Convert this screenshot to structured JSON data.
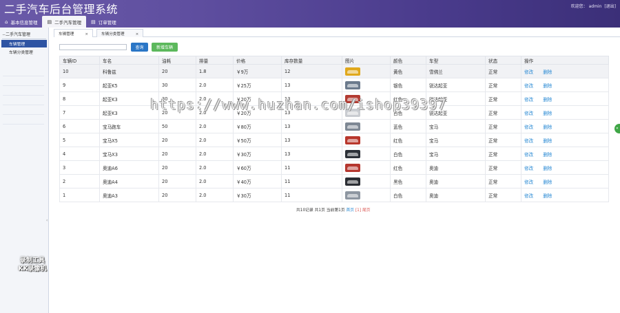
{
  "header": {
    "title": "二手汽车后台管理系统",
    "welcome": "欢迎您：",
    "username": "admin",
    "logout": "[退出]"
  },
  "topnav": [
    {
      "label": "基本信息管理",
      "icon": "home-icon"
    },
    {
      "label": "二手汽车管理",
      "icon": "document-icon"
    },
    {
      "label": "订单管理",
      "icon": "document-icon"
    }
  ],
  "sidebar": {
    "group": "二手汽车管理",
    "items": [
      "车辆管理",
      "车辆分类管理"
    ]
  },
  "tabs": [
    "车辆管理",
    "车辆分类管理"
  ],
  "toolbar": {
    "search_value": "",
    "query_label": "查询",
    "add_label": "新增车辆"
  },
  "table": {
    "headers": [
      "车辆ID",
      "车名",
      "油耗",
      "排量",
      "价格",
      "库存数量",
      "图片",
      "颜色",
      "车型",
      "状态",
      "操作"
    ],
    "edit_label": "修改",
    "delete_label": "删除",
    "rows": [
      {
        "id": "10",
        "name": "科鲁兹",
        "fuel": "20",
        "displacement": "1.8",
        "price": "￥9万",
        "stock": "12",
        "thumb_color": "#e0a81c",
        "color": "黄色",
        "model": "雪佛兰",
        "status": "正常"
      },
      {
        "id": "9",
        "name": "起亚K5",
        "fuel": "30",
        "displacement": "2.0",
        "price": "￥25万",
        "stock": "13",
        "thumb_color": "#6b7a8c",
        "color": "银色",
        "model": "锐达起亚",
        "status": "正常"
      },
      {
        "id": "8",
        "name": "起亚K3",
        "fuel": "30",
        "displacement": "2.0",
        "price": "￥20万",
        "stock": "13",
        "thumb_color": "#b23b32",
        "color": "红色",
        "model": "锐达起亚",
        "status": "正常"
      },
      {
        "id": "7",
        "name": "起亚K3",
        "fuel": "20",
        "displacement": "2.0",
        "price": "￥20万",
        "stock": "13",
        "thumb_color": "#c9ccd1",
        "color": "白色",
        "model": "锐达起亚",
        "status": "正常"
      },
      {
        "id": "6",
        "name": "宝马跑车",
        "fuel": "50",
        "displacement": "2.0",
        "price": "￥80万",
        "stock": "13",
        "thumb_color": "#7e8894",
        "color": "蓝色",
        "model": "宝马",
        "status": "正常"
      },
      {
        "id": "5",
        "name": "宝马X5",
        "fuel": "20",
        "displacement": "2.0",
        "price": "￥50万",
        "stock": "13",
        "thumb_color": "#b8362c",
        "color": "红色",
        "model": "宝马",
        "status": "正常"
      },
      {
        "id": "4",
        "name": "宝马X3",
        "fuel": "20",
        "displacement": "2.0",
        "price": "￥30万",
        "stock": "13",
        "thumb_color": "#2d3138",
        "color": "白色",
        "model": "宝马",
        "status": "正常"
      },
      {
        "id": "3",
        "name": "奥迪A6",
        "fuel": "20",
        "displacement": "2.0",
        "price": "￥60万",
        "stock": "11",
        "thumb_color": "#b5372f",
        "color": "红色",
        "model": "奥迪",
        "status": "正常"
      },
      {
        "id": "2",
        "name": "奥迪A4",
        "fuel": "20",
        "displacement": "2.0",
        "price": "￥40万",
        "stock": "11",
        "thumb_color": "#2a2d33",
        "color": "黑色",
        "model": "奥迪",
        "status": "正常"
      },
      {
        "id": "1",
        "name": "奥迪A3",
        "fuel": "20",
        "displacement": "2.0",
        "price": "￥30万",
        "stock": "11",
        "thumb_color": "#8d96a1",
        "color": "白色",
        "model": "奥迪",
        "status": "正常"
      }
    ]
  },
  "pager": {
    "summary": "共10记录 共1页 当前第1页",
    "first": "首页",
    "current": "[1]",
    "last": "尾页"
  },
  "watermark": "https://www.huzhan.com/ishop39397",
  "recorder_logo": [
    "录制工具",
    "KK录像机"
  ],
  "float_button_icon": "double-chevron-left-icon"
}
